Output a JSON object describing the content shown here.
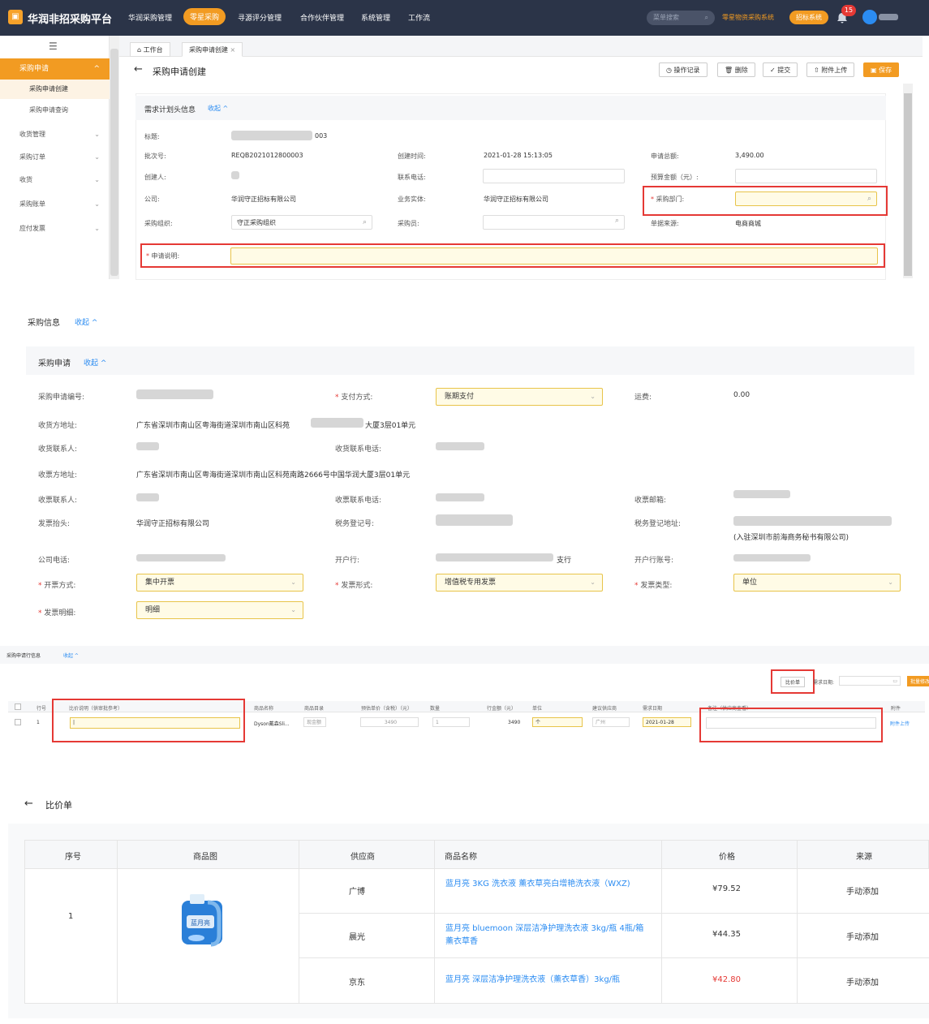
{
  "app": {
    "title": "华润非招采购平台"
  },
  "topnav": {
    "items": [
      "华润采购管理",
      "零星采购",
      "寻源评分管理",
      "合作伙伴管理",
      "系统管理",
      "工作流"
    ],
    "active_index": 1,
    "search_placeholder": "菜单搜索",
    "link": "零星物资采购系统",
    "button": "招标系统",
    "badge": "15"
  },
  "sidebar": {
    "menu": "采购申请",
    "sub": [
      "采购申请创建",
      "采购申请查询"
    ],
    "items": [
      "收货管理",
      "采购订单",
      "收货",
      "采购账单",
      "应付发票"
    ]
  },
  "tabs": [
    "工作台",
    "采购申请创建"
  ],
  "page": {
    "title": "采购申请创建",
    "toolbar": [
      "操作记录",
      "删除",
      "提交",
      "附件上传",
      "保存"
    ]
  },
  "header_section": {
    "title": "需求计划头信息",
    "collapse": "收起",
    "fields": {
      "title_label": "标题:",
      "title_value": "003",
      "batch_label": "批次号:",
      "batch_value": "REQB2021012800003",
      "created_label": "创建时间:",
      "created_value": "2021-01-28 15:13:05",
      "total_label": "申请总额:",
      "total_value": "3,490.00",
      "creator_label": "创建人:",
      "phone_label": "联系电话:",
      "budget_label": "预算金额（元）:",
      "company_label": "公司:",
      "company_value": "华润守正招标有限公司",
      "entity_label": "业务实体:",
      "entity_value": "华润守正招标有限公司",
      "dept_label": "采购部门:",
      "org_label": "采购组织:",
      "org_value": "守正采购组织",
      "buyer_label": "采购员:",
      "source_label": "单据来源:",
      "source_value": "电商商城",
      "desc_label": "申请说明:"
    }
  },
  "purchase_info": {
    "title": "采购信息",
    "collapse": "收起"
  },
  "purchase_request": {
    "title": "采购申请",
    "collapse": "收起",
    "no_label": "采购申请编号:",
    "pay_label": "支付方式:",
    "pay_value": "账期支付",
    "freight_label": "运费:",
    "freight_value": "0.00",
    "recv_addr_label": "收货方地址:",
    "recv_addr_value": "广东省深圳市南山区粤海街道深圳市南山区科苑",
    "recv_addr_tail": "大厦3层01单元",
    "recv_contact_label": "收货联系人:",
    "recv_phone_label": "收货联系电话:",
    "inv_addr_label": "收票方地址:",
    "inv_addr_value": "广东省深圳市南山区粤海街道深圳市南山区科苑南路2666号中国华润大厦3层01单元",
    "inv_contact_label": "收票联系人:",
    "inv_phone_label": "收票联系电话:",
    "inv_email_label": "收票邮箱:",
    "inv_title_label": "发票抬头:",
    "inv_title_value": "华润守正招标有限公司",
    "tax_label": "税务登记号:",
    "tax_addr_label": "税务登记地址:",
    "tax_addr_sub": "(入驻深圳市前海商务秘书有限公司)",
    "co_phone_label": "公司电话:",
    "bank_label": "开户行:",
    "bank_tail": "支行",
    "account_label": "开户行账号:",
    "inv_mode_label": "开票方式:",
    "inv_mode_value": "集中开票",
    "inv_form_label": "发票形式:",
    "inv_form_value": "增值税专用发票",
    "inv_type_label": "发票类型:",
    "inv_type_value": "单位",
    "inv_detail_label": "发票明细:",
    "inv_detail_value": "明细"
  },
  "line_section": {
    "title": "采购申请行信息",
    "collapse": "收起",
    "compare_btn": "比价单",
    "date_label": "需求日期:",
    "batch_btn": "批量修改",
    "headers": [
      "行号",
      "比价说明（供审批参考）",
      "商品名称",
      "商品目录",
      "预估单价（含税）（元）",
      "数量",
      "行金额（元）",
      "单位",
      "建议供应商",
      "需求日期",
      "备注（供应商查看）",
      "附件"
    ],
    "row": {
      "no": "1",
      "name": "Dyson戴森Sli...",
      "catalog": "现金额",
      "price": "3490",
      "qty": "1",
      "amount": "3490",
      "unit": "个",
      "supplier": "广州",
      "date": "2021-01-28",
      "attach": "附件上传"
    }
  },
  "compare": {
    "title": "比价单",
    "headers": [
      "序号",
      "商品图",
      "供应商",
      "商品名称",
      "价格",
      "来源"
    ],
    "index": "1",
    "rows": [
      {
        "supplier": "广博",
        "name": "蓝月亮 3KG 洗衣液 薰衣草亮白增艳洗衣液（WXZ)",
        "price": "¥79.52",
        "source": "手动添加"
      },
      {
        "supplier": "晨光",
        "name": "蓝月亮 bluemoon 深层洁净护理洗衣液 3kg/瓶 4瓶/箱 薰衣草香",
        "price": "¥44.35",
        "source": "手动添加"
      },
      {
        "supplier": "京东",
        "name": "蓝月亮 深层洁净护理洗衣液（薰衣草香）3kg/瓶",
        "price": "¥42.80",
        "source": "手动添加"
      }
    ],
    "product_label": "蓝月亮"
  },
  "colors": {
    "accent": "#f29b22",
    "nav": "#2b3448",
    "link": "#2b8cf2",
    "required": "#e53935",
    "lowest_price": "#e53935"
  }
}
